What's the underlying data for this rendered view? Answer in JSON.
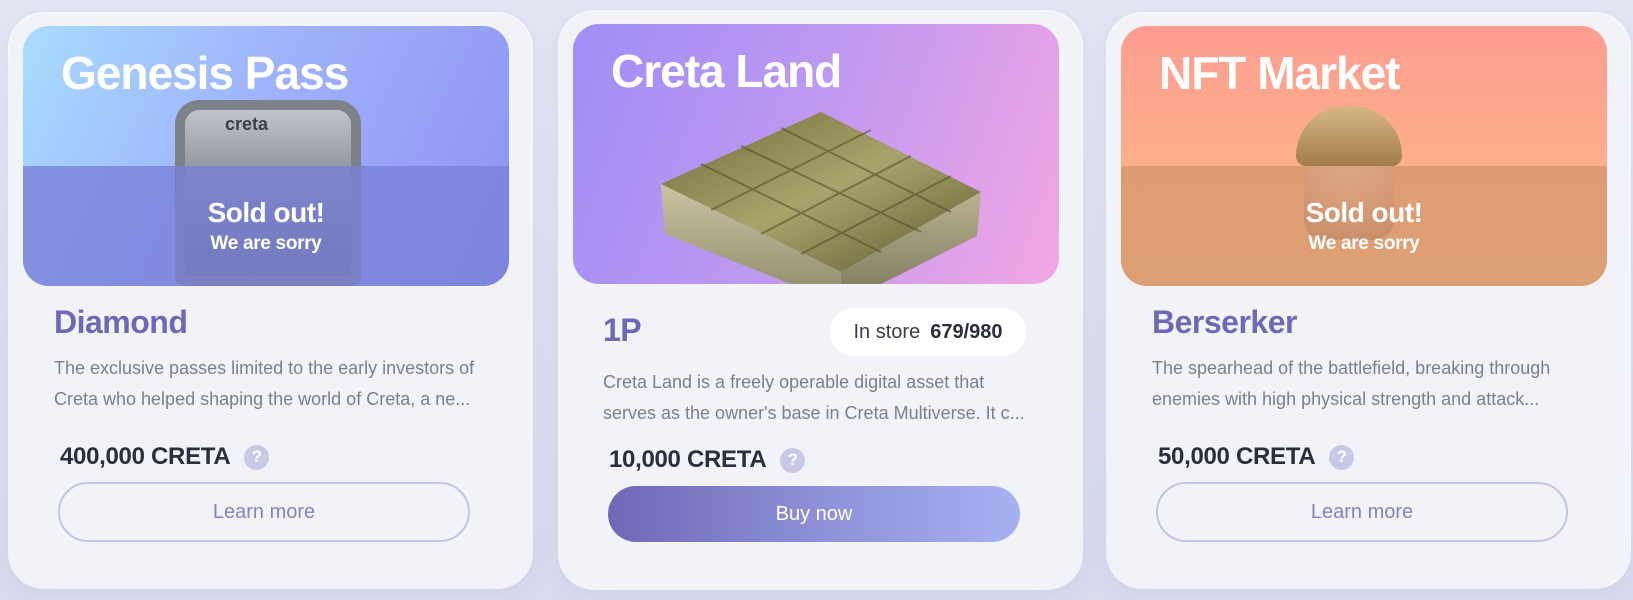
{
  "cards": [
    {
      "banner_title": "Genesis Pass",
      "art_logo": "creta",
      "sold_out_title": "Sold out!",
      "sold_out_subtitle": "We are sorry",
      "item_name": "Diamond",
      "description": "The exclusive passes limited to the early investors of Creta who helped shaping the world of Creta, a ne...",
      "price": "400,000 CRETA",
      "help_icon": "?",
      "button_label": "Learn more"
    },
    {
      "banner_title": "Creta Land",
      "item_name": "1P",
      "store_label": "In store",
      "store_value": "679/980",
      "description": "Creta Land is a freely operable digital asset that serves as the owner's base in Creta Multiverse. It c...",
      "price": "10,000 CRETA",
      "help_icon": "?",
      "button_label": "Buy now"
    },
    {
      "banner_title": "NFT Market",
      "sold_out_title": "Sold out!",
      "sold_out_subtitle": "We are sorry",
      "item_name": "Berserker",
      "description": "The spearhead of the battlefield, breaking through enemies with high physical strength and attack...",
      "price": "50,000 CRETA",
      "help_icon": "?",
      "button_label": "Learn more"
    }
  ],
  "colors": {
    "accent": "#7067b8",
    "card_bg": "#f2f3f9",
    "button_gradient_start": "#6f68b6",
    "button_gradient_end": "#a6b1f2"
  }
}
